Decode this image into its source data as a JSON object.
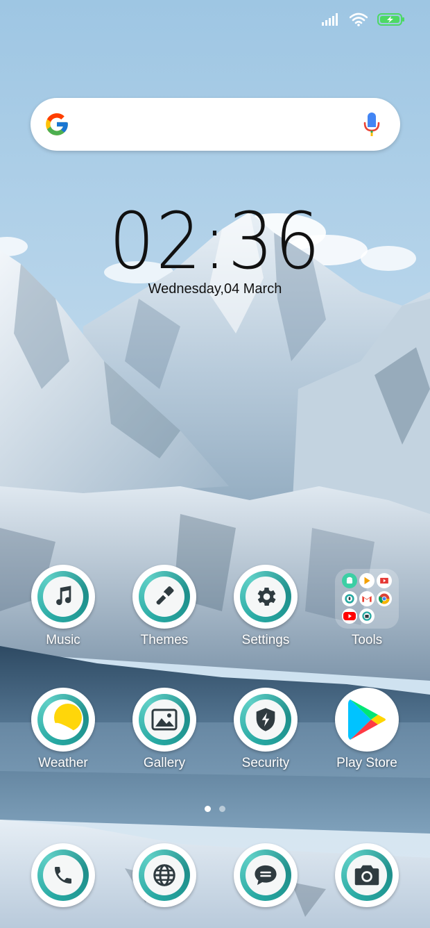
{
  "status_bar": {
    "icons": [
      "signal-icon",
      "wifi-icon",
      "battery-charging-icon"
    ],
    "battery_color": "#4cd964"
  },
  "search": {
    "placeholder": "",
    "value": ""
  },
  "clock": {
    "time": "02:36",
    "date": "Wednesday,04 March"
  },
  "apps": [
    {
      "label": "Music",
      "icon": "music-note-icon"
    },
    {
      "label": "Themes",
      "icon": "paintbrush-icon"
    },
    {
      "label": "Settings",
      "icon": "gear-icon"
    },
    {
      "label": "Tools",
      "icon": "folder-icon"
    },
    {
      "label": "Weather",
      "icon": "weather-sun-icon"
    },
    {
      "label": "Gallery",
      "icon": "image-icon"
    },
    {
      "label": "Security",
      "icon": "shield-icon"
    },
    {
      "label": "Play Store",
      "icon": "play-store-icon"
    }
  ],
  "dock": [
    {
      "icon": "phone-icon"
    },
    {
      "icon": "browser-globe-icon"
    },
    {
      "icon": "messages-icon"
    },
    {
      "icon": "camera-icon"
    }
  ],
  "pages": {
    "current": 1,
    "total": 2
  },
  "colors": {
    "accent_teal": "#27a8a2",
    "icon_dark": "#2f3b40",
    "weather_sun": "#ffd60a"
  }
}
